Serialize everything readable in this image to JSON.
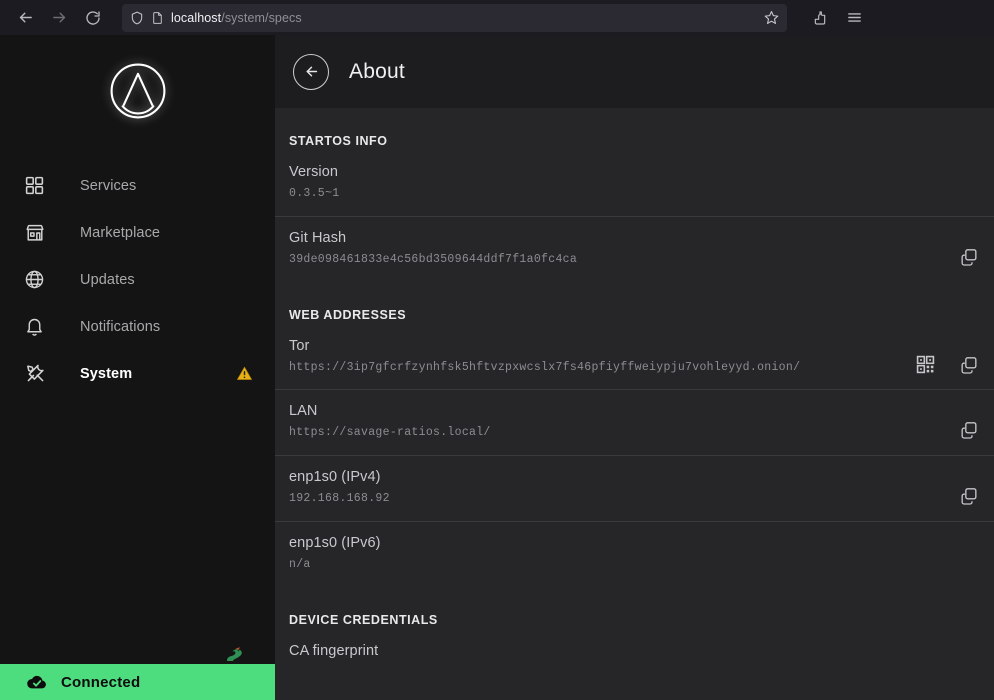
{
  "browser": {
    "back_label": "Back",
    "forward_label": "Forward",
    "reload_label": "Reload",
    "shield_icon": "shield-icon",
    "page_icon": "page-icon",
    "url_host": "localhost",
    "url_path": "/system/specs",
    "bookmark_icon": "star-icon",
    "extensions_icon": "extensions-icon",
    "menu_icon": "hamburger-menu-icon"
  },
  "sidebar": {
    "logo_name": "startos-logo",
    "items": [
      {
        "label": "Services",
        "icon": "grid-icon",
        "active": false,
        "badge": ""
      },
      {
        "label": "Marketplace",
        "icon": "store-icon",
        "active": false,
        "badge": ""
      },
      {
        "label": "Updates",
        "icon": "globe-icon",
        "active": false,
        "badge": ""
      },
      {
        "label": "Notifications",
        "icon": "bell-icon",
        "active": false,
        "badge": ""
      },
      {
        "label": "System",
        "icon": "tools-icon",
        "active": true,
        "badge": "warning-triangle-icon"
      }
    ],
    "snake_icon": "snake-icon",
    "status": {
      "text": "Connected",
      "icon": "cloud-check-icon",
      "color": "#4ddc7e"
    }
  },
  "main": {
    "header": {
      "back_icon": "arrow-left-icon",
      "title": "About"
    },
    "sections": [
      {
        "heading": "STARTOS INFO",
        "rows": [
          {
            "label": "Version",
            "value": "0.3.5~1",
            "actions": []
          },
          {
            "label": "Git Hash",
            "value": "39de098461833e4c56bd3509644ddf7f1a0fc4ca",
            "actions": [
              "copy-icon"
            ]
          }
        ]
      },
      {
        "heading": "WEB ADDRESSES",
        "rows": [
          {
            "label": "Tor",
            "value": "https://3ip7gfcrfzynhfsk5hftvzpxwcslx7fs46pfiyffweiypju7vohleyyd.onion/",
            "actions": [
              "qr-code-icon",
              "copy-icon"
            ]
          },
          {
            "label": "LAN",
            "value": "https://savage-ratios.local/",
            "actions": [
              "copy-icon"
            ]
          },
          {
            "label": "enp1s0 (IPv4)",
            "value": "192.168.168.92",
            "actions": [
              "copy-icon"
            ]
          },
          {
            "label": "enp1s0 (IPv6)",
            "value": "n/a",
            "actions": []
          }
        ]
      },
      {
        "heading": "DEVICE CREDENTIALS",
        "rows": [
          {
            "label": "CA fingerprint",
            "value": "",
            "actions": []
          }
        ]
      }
    ]
  }
}
